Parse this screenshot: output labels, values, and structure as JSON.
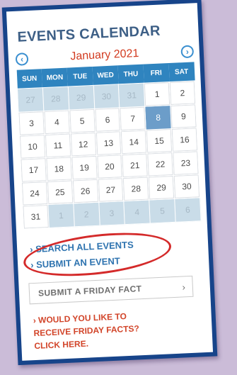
{
  "title": "EVENTS CALENDAR",
  "month_label": "January 2021",
  "nav": {
    "prev_icon": "chevron-left",
    "next_icon": "chevron-right"
  },
  "weekdays": [
    "SUN",
    "MON",
    "TUE",
    "WED",
    "THU",
    "FRI",
    "SAT"
  ],
  "weeks": [
    [
      {
        "day": "27",
        "current": false
      },
      {
        "day": "28",
        "current": false
      },
      {
        "day": "29",
        "current": false
      },
      {
        "day": "30",
        "current": false
      },
      {
        "day": "31",
        "current": false
      },
      {
        "day": "1",
        "current": true
      },
      {
        "day": "2",
        "current": true
      }
    ],
    [
      {
        "day": "3",
        "current": true
      },
      {
        "day": "4",
        "current": true
      },
      {
        "day": "5",
        "current": true
      },
      {
        "day": "6",
        "current": true
      },
      {
        "day": "7",
        "current": true
      },
      {
        "day": "8",
        "current": true,
        "today": true
      },
      {
        "day": "9",
        "current": true
      }
    ],
    [
      {
        "day": "10",
        "current": true
      },
      {
        "day": "11",
        "current": true
      },
      {
        "day": "12",
        "current": true
      },
      {
        "day": "13",
        "current": true
      },
      {
        "day": "14",
        "current": true
      },
      {
        "day": "15",
        "current": true
      },
      {
        "day": "16",
        "current": true
      }
    ],
    [
      {
        "day": "17",
        "current": true
      },
      {
        "day": "18",
        "current": true
      },
      {
        "day": "19",
        "current": true
      },
      {
        "day": "20",
        "current": true
      },
      {
        "day": "21",
        "current": true
      },
      {
        "day": "22",
        "current": true
      },
      {
        "day": "23",
        "current": true
      }
    ],
    [
      {
        "day": "24",
        "current": true
      },
      {
        "day": "25",
        "current": true
      },
      {
        "day": "26",
        "current": true
      },
      {
        "day": "27",
        "current": true
      },
      {
        "day": "28",
        "current": true
      },
      {
        "day": "29",
        "current": true
      },
      {
        "day": "30",
        "current": true
      }
    ],
    [
      {
        "day": "31",
        "current": true
      },
      {
        "day": "1",
        "current": false
      },
      {
        "day": "2",
        "current": false
      },
      {
        "day": "3",
        "current": false
      },
      {
        "day": "4",
        "current": false
      },
      {
        "day": "5",
        "current": false
      },
      {
        "day": "6",
        "current": false
      }
    ]
  ],
  "links": {
    "search_all": "› SEARCH ALL EVENTS",
    "submit_event": "› SUBMIT AN EVENT"
  },
  "fact_button": {
    "label": "SUBMIT A FRIDAY FACT",
    "arrow": "›"
  },
  "promo": {
    "line1": "› WOULD YOU LIKE TO",
    "line2": "RECEIVE FRIDAY FACTS?",
    "line3": "CLICK HERE."
  },
  "colors": {
    "frame": "#17448a",
    "background": "#cbbcd8",
    "header_bar": "#2f84bf",
    "month": "#d23a1f",
    "link": "#2f74b0",
    "highlight_circle": "#d42a2a",
    "promo": "#d2452a",
    "today": "#6c9dc9"
  }
}
